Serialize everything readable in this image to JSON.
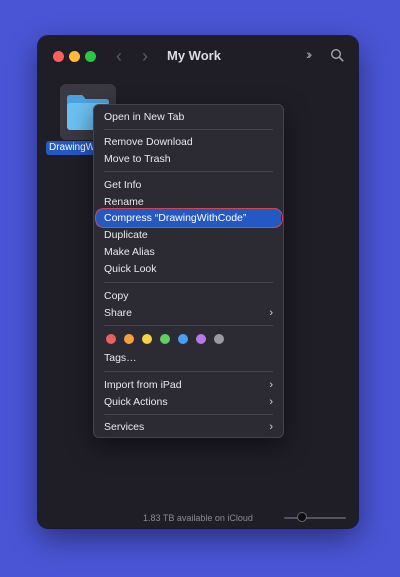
{
  "window": {
    "title": "My Work"
  },
  "folder": {
    "label": "DrawingWithCode",
    "icon": "folder-icon",
    "selected": true
  },
  "context_menu": {
    "items": {
      "open_new_tab": "Open in New Tab",
      "remove_download": "Remove Download",
      "move_to_trash": "Move to Trash",
      "get_info": "Get Info",
      "rename": "Rename",
      "compress": "Compress “DrawingWithCode”",
      "duplicate": "Duplicate",
      "make_alias": "Make Alias",
      "quick_look": "Quick Look",
      "copy": "Copy",
      "share": "Share",
      "tags": "Tags…",
      "import_ipad": "Import from iPad",
      "quick_actions": "Quick Actions",
      "services": "Services"
    },
    "highlighted": "compress",
    "tag_colors": [
      "#ec5f5f",
      "#f0a33c",
      "#f5d344",
      "#5fcf5f",
      "#4a9ff5",
      "#b977e8",
      "#9a9aa0"
    ]
  },
  "status_bar": {
    "text": "1.83 TB available on iCloud"
  },
  "colors": {
    "accent": "#2459c4",
    "annotation_ring": "#d64545",
    "background": "#4a55d6"
  }
}
